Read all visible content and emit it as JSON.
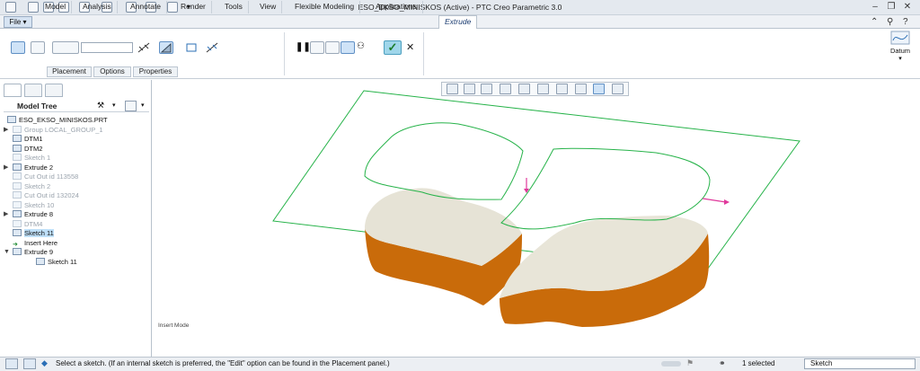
{
  "window": {
    "title": "ESO_EKSO_MINISKOS (Active) - PTC Creo Parametric 3.0"
  },
  "menu": {
    "file": "File ▾",
    "tabs": [
      "Model",
      "Analysis",
      "Annotate",
      "Render",
      "Tools",
      "View",
      "Flexible Modeling",
      "Applications"
    ],
    "active_tab": "Extrude"
  },
  "ribbon": {
    "subtabs": [
      "Placement",
      "Options",
      "Properties"
    ],
    "datum_label": "Datum"
  },
  "model_tree": {
    "title": "Model Tree",
    "items": [
      {
        "label": "ESO_EKSO_MINISKOS.PRT",
        "icon": "part-icon",
        "state": "normal",
        "expander": ""
      },
      {
        "label": "Group LOCAL_GROUP_1",
        "icon": "group-icon",
        "state": "dim",
        "expander": "▶"
      },
      {
        "label": "DTM1",
        "icon": "datum-plane-icon",
        "state": "normal",
        "expander": ""
      },
      {
        "label": "DTM2",
        "icon": "datum-plane-icon",
        "state": "normal",
        "expander": ""
      },
      {
        "label": "Sketch 1",
        "icon": "sketch-icon",
        "state": "dim",
        "expander": ""
      },
      {
        "label": "Extrude 2",
        "icon": "extrude-icon",
        "state": "normal",
        "expander": "▶"
      },
      {
        "label": "Cut Out id 113558",
        "icon": "cut-icon",
        "state": "dim",
        "expander": ""
      },
      {
        "label": "Sketch 2",
        "icon": "sketch-icon",
        "state": "dim",
        "expander": ""
      },
      {
        "label": "Cut Out id 132024",
        "icon": "cut-icon",
        "state": "dim",
        "expander": ""
      },
      {
        "label": "Sketch 10",
        "icon": "sketch-icon",
        "state": "dim",
        "expander": ""
      },
      {
        "label": "Extrude 8",
        "icon": "extrude-icon",
        "state": "normal",
        "expander": "▶"
      },
      {
        "label": "DTM4",
        "icon": "datum-plane-icon",
        "state": "dim",
        "expander": ""
      },
      {
        "label": "Sketch 11",
        "icon": "sketch-icon",
        "state": "selected",
        "expander": ""
      },
      {
        "label": "Insert Here",
        "icon": "insert-arrow-icon",
        "state": "normal",
        "expander": ""
      },
      {
        "label": "Extrude 9",
        "icon": "extrude-icon",
        "state": "normal",
        "expander": "▼"
      },
      {
        "label": "Sketch 11",
        "icon": "sketch-icon",
        "state": "normal",
        "expander": "",
        "child": true
      }
    ]
  },
  "viewport": {
    "mode_label": "Insert Mode"
  },
  "status": {
    "message": "Select a sketch. (If an internal sketch is preferred, the \"Edit\" option can be found in the Placement panel.)",
    "selected": "1 selected",
    "filter": "Sketch"
  },
  "colors": {
    "accent": "#2b6fb6",
    "solid_side": "#c96b0a",
    "sketch_outline": "#27b34a",
    "ok_green": "#1b7d2a"
  }
}
